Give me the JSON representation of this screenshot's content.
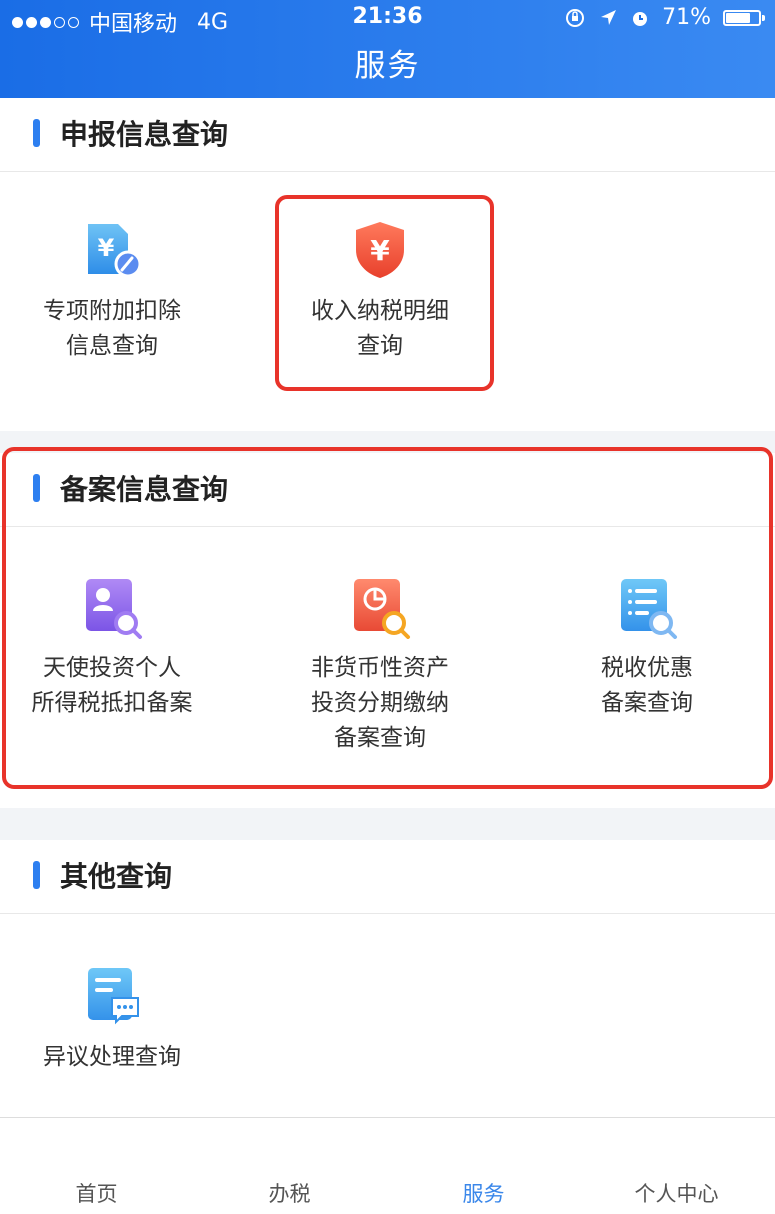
{
  "status_bar": {
    "carrier": "中国移动",
    "network": "4G",
    "time": "21:36",
    "battery": "71%",
    "battery_level": 0.71
  },
  "header": {
    "title": "服务"
  },
  "sections": [
    {
      "title": "申报信息查询",
      "items": [
        {
          "label_line1": "专项附加扣除",
          "label_line2": "信息查询",
          "icon": "yuan-document-edit-icon"
        },
        {
          "label_line1": "收入纳税明细",
          "label_line2": "查询",
          "icon": "yuan-shield-icon"
        }
      ]
    },
    {
      "title": "备案信息查询",
      "items": [
        {
          "label_line1": "天使投资个人",
          "label_line2": "所得税抵扣备案",
          "icon": "person-search-icon"
        },
        {
          "label_line1": "非货币性资产",
          "label_line2": "投资分期缴纳",
          "label_line3": "备案查询",
          "icon": "pie-chart-search-icon"
        },
        {
          "label_line1": "税收优惠",
          "label_line2": "备案查询",
          "icon": "list-search-icon"
        }
      ]
    },
    {
      "title": "其他查询",
      "items": [
        {
          "label_line1": "异议处理查询",
          "icon": "document-chat-icon"
        }
      ]
    }
  ],
  "tabbar": {
    "tabs": [
      {
        "label": "首页"
      },
      {
        "label": "办税"
      },
      {
        "label": "服务",
        "active": true
      },
      {
        "label": "个人中心"
      }
    ]
  },
  "colors": {
    "header_gradient_start": "#1a6de6",
    "header_gradient_end": "#3a8af2",
    "section_accent": "#2d7ff0",
    "highlight_border": "#e8332a",
    "active_tab": "#3a87ea"
  }
}
